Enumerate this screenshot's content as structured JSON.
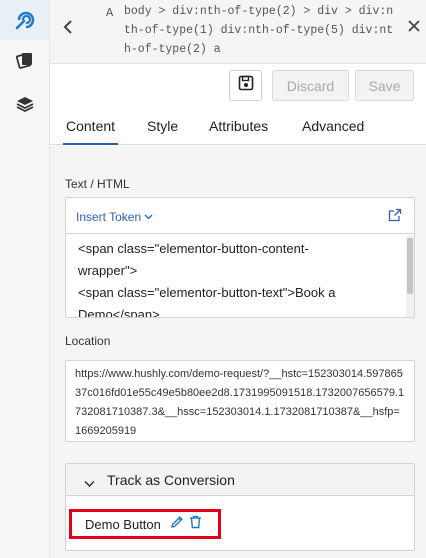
{
  "header": {
    "selector_type": "A",
    "selector_path": "body > div:nth-of-type(2) > div > div:nth-of-type(1) div:nth-of-type(5) div:nth-of-type(2) a"
  },
  "toolbar": {
    "discard_label": "Discard",
    "save_label": "Save"
  },
  "tabs": [
    {
      "label": "Content",
      "active": true
    },
    {
      "label": "Style",
      "active": false
    },
    {
      "label": "Attributes",
      "active": false
    },
    {
      "label": "Advanced",
      "active": false
    }
  ],
  "content": {
    "text_html_label": "Text / HTML",
    "insert_token_label": "Insert Token",
    "html_lines": [
      "<span class=\"elementor-button-content-",
      "wrapper\">",
      "<span class=\"elementor-button-text\">Book a",
      "Demo</span>"
    ],
    "location_label": "Location",
    "location_value": "https://www.hushly.com/demo-request/?__hstc=152303014.59786537c016fd01e55c49e5b80ee2d8.1731995091518.1732007656579.1732081710387.3&__hssc=152303014.1.1732081710387&__hsfp=1669205919",
    "conversion": {
      "title": "Track as Conversion",
      "items": [
        {
          "name": "Demo Button"
        }
      ]
    }
  },
  "icons": {
    "rail": [
      "hushly-logo-icon",
      "cards-icon",
      "layers-icon"
    ],
    "accent": "#2b5fb4",
    "highlight": "#e3001b"
  }
}
